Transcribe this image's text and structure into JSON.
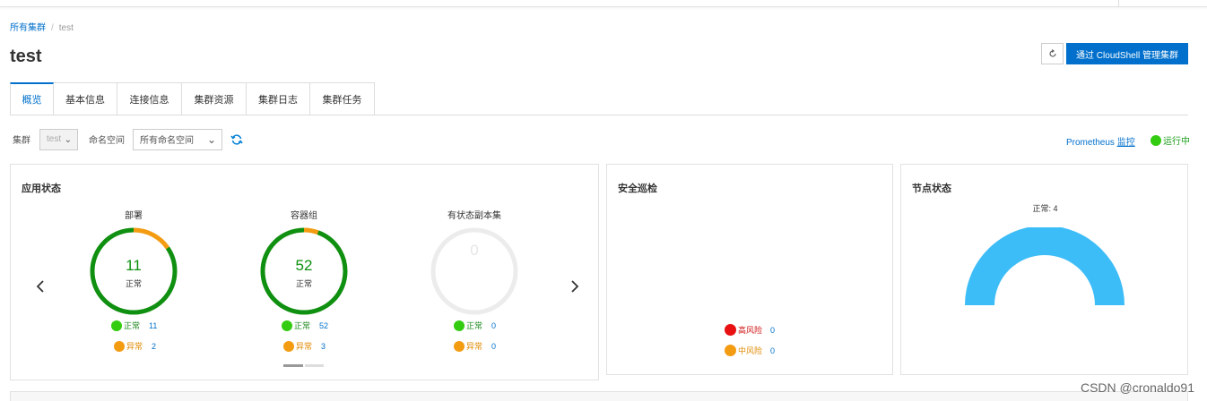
{
  "breadcrumb": {
    "root": "所有集群",
    "separator": "/",
    "current": "test"
  },
  "page_title": "test",
  "header_actions": {
    "refresh_icon": "refresh-icon",
    "cloudshell_label": "通过 CloudShell 管理集群"
  },
  "tabs": [
    {
      "label": "概览",
      "active": true
    },
    {
      "label": "基本信息"
    },
    {
      "label": "连接信息"
    },
    {
      "label": "集群资源"
    },
    {
      "label": "集群日志"
    },
    {
      "label": "集群任务"
    }
  ],
  "filters": {
    "cluster_label": "集群",
    "cluster_value": "test",
    "namespace_label": "命名空间",
    "namespace_value": "所有命名空间"
  },
  "monitor": {
    "prefix": "Prometheus",
    "link": "监控",
    "status": "运行中"
  },
  "app_status": {
    "title": "应用状态",
    "gauges": [
      {
        "title": "部署",
        "total": "11",
        "status_text": "正常",
        "normal_label": "正常",
        "normal_count": "11",
        "abnormal_label": "异常",
        "abnormal_count": "2",
        "normal_fraction": 0.846
      },
      {
        "title": "容器组",
        "total": "52",
        "status_text": "正常",
        "normal_label": "正常",
        "normal_count": "52",
        "abnormal_label": "异常",
        "abnormal_count": "3",
        "normal_fraction": 0.945
      },
      {
        "title": "有状态副本集",
        "total": "0",
        "status_text": "",
        "normal_label": "正常",
        "normal_count": "0",
        "abnormal_label": "异常",
        "abnormal_count": "0",
        "normal_fraction": 0
      }
    ]
  },
  "security": {
    "title": "安全巡检",
    "high_label": "高风险",
    "high_count": "0",
    "medium_label": "中风险",
    "medium_count": "0"
  },
  "node_status": {
    "title": "节点状态",
    "label": "正常: 4",
    "normal_nodes": 4
  },
  "colors": {
    "primary": "#0070cc",
    "normal": "#109010",
    "abnormal": "#f39c12",
    "high_risk": "#e81010",
    "node": "#3dbdf7",
    "legend_green": "#33cc11"
  },
  "watermark": "CSDN @cronaldo91"
}
